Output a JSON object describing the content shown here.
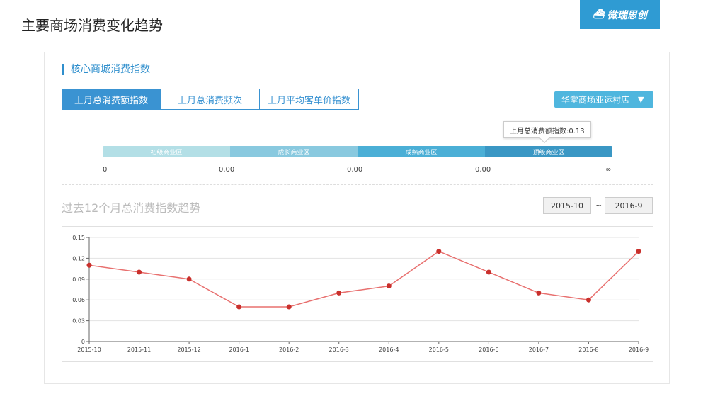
{
  "header": {
    "page_title": "主要商场消费变化趋势",
    "brand": "微瑞思创"
  },
  "section": {
    "title": "核心商城消费指数"
  },
  "tabs": [
    {
      "label": "上月总消费额指数",
      "active": true
    },
    {
      "label": "上月总消费频次",
      "active": false
    },
    {
      "label": "上月平均客单价指数",
      "active": false
    }
  ],
  "store_select": {
    "value": "华堂商场亚运村店"
  },
  "tooltip": {
    "text": "上月总消费额指数:0.13"
  },
  "zones": [
    {
      "label": "初级商业区",
      "color": "#b3dfe6"
    },
    {
      "label": "成长商业区",
      "color": "#89c9df"
    },
    {
      "label": "成熟商业区",
      "color": "#4bafd6"
    },
    {
      "label": "顶级商业区",
      "color": "#3a97c4"
    }
  ],
  "zone_values": [
    "0",
    "0.00",
    "0.00",
    "0.00",
    "∞"
  ],
  "trend": {
    "title": "过去12个月总消费指数趋势",
    "date_from": "2015-10",
    "date_sep": "~",
    "date_to": "2016-9"
  },
  "chart_data": {
    "type": "line",
    "categories": [
      "2015-10",
      "2015-11",
      "2015-12",
      "2016-1",
      "2016-2",
      "2016-3",
      "2016-4",
      "2016-5",
      "2016-6",
      "2016-7",
      "2016-8",
      "2016-9"
    ],
    "series": [
      {
        "values": [
          0.11,
          0.1,
          0.09,
          0.05,
          0.05,
          0.07,
          0.08,
          0.13,
          0.1,
          0.07,
          0.06,
          0.13
        ]
      }
    ],
    "ylim": [
      0,
      0.15
    ],
    "yticks": [
      "0",
      "0.03",
      "0.06",
      "0.09",
      "0.12",
      "0.15"
    ],
    "grid": true,
    "line_color": "#e8706f",
    "point_color": "#c9302c"
  }
}
